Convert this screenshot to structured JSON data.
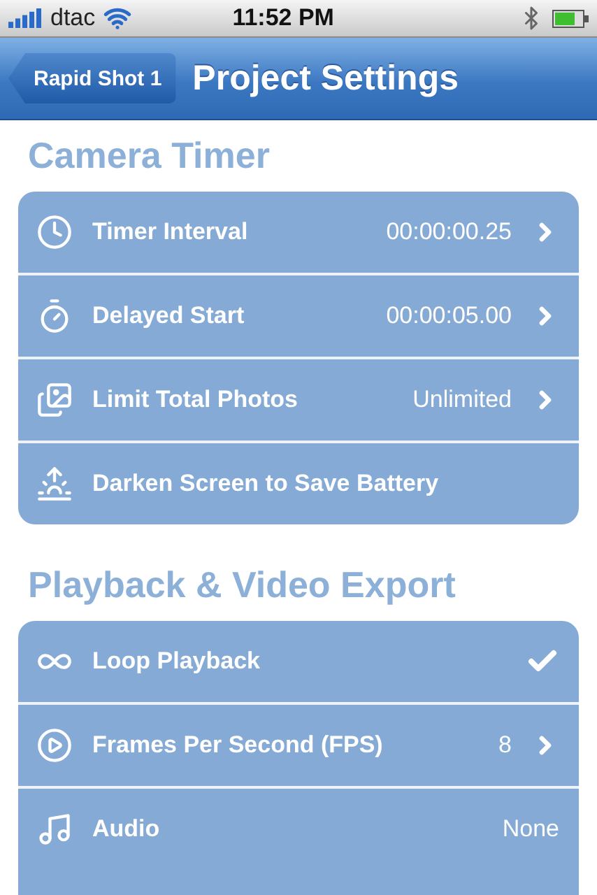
{
  "status_bar": {
    "carrier": "dtac",
    "time": "11:52 PM"
  },
  "nav_bar": {
    "back": "Rapid Shot 1",
    "title": "Project Settings"
  },
  "sections": [
    {
      "title": "Camera Timer",
      "rows": [
        {
          "kind": "link",
          "label": "Timer Interval",
          "value": "00:00:00.25"
        },
        {
          "kind": "link",
          "label": "Delayed Start",
          "value": "00:00:05.00"
        },
        {
          "kind": "link",
          "label": "Limit Total Photos",
          "value": "Unlimited"
        },
        {
          "kind": "plain",
          "label": "Darken Screen to Save Battery"
        }
      ]
    },
    {
      "title": "Playback & Video Export",
      "rows": [
        {
          "kind": "toggle",
          "label": "Loop Playback",
          "checked": true
        },
        {
          "kind": "link",
          "label": "Frames Per Second (FPS)",
          "value": "8"
        },
        {
          "kind": "plain",
          "label": "Audio",
          "value": "None"
        }
      ]
    }
  ]
}
